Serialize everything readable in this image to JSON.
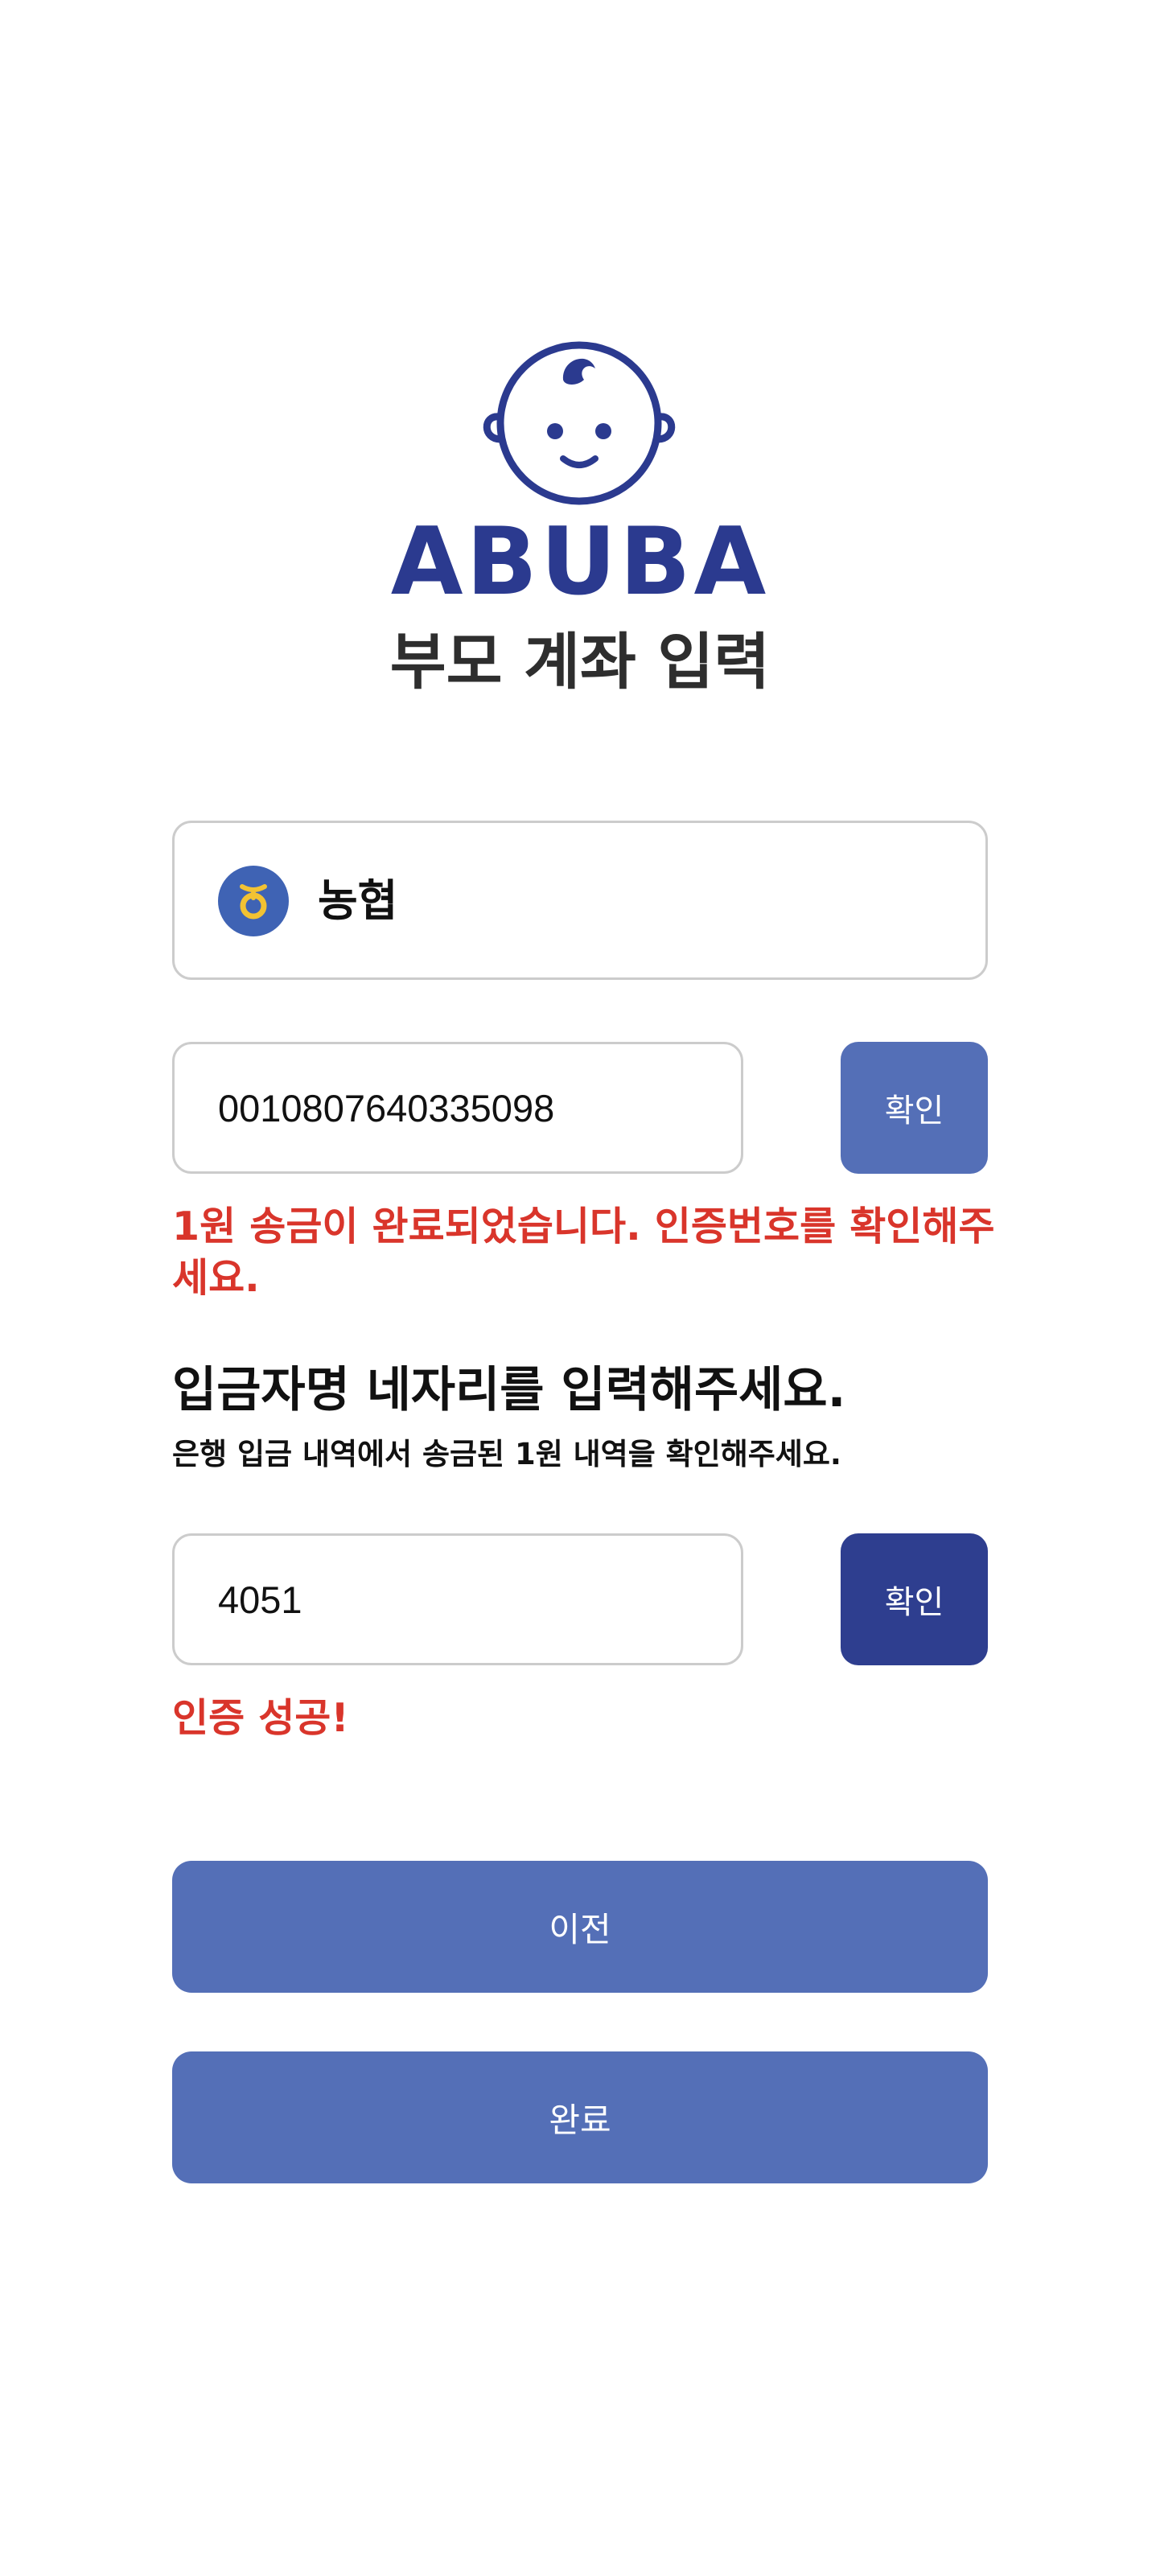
{
  "brand": {
    "name": "ABUBA",
    "logo_icon": "baby-face-icon",
    "color": "#2b3a8f"
  },
  "page_title": "부모 계좌 입력",
  "bank": {
    "name": "농협",
    "icon": "nh-bank-icon",
    "icon_color": "#3f63b4",
    "icon_mark_color": "#f2c233"
  },
  "account": {
    "value": "0010807640335098",
    "confirm_label": "확인",
    "confirm_color": "#546fb7",
    "message": "1원 송금이 완료되었습니다. 인증번호를 확인해주세요."
  },
  "verify": {
    "title": "입금자명 네자리를 입력해주세요.",
    "subtitle": "은행 입금 내역에서 송금된 1원 내역을 확인해주세요.",
    "value": "4051",
    "confirm_label": "확인",
    "confirm_color": "#2e3e8f",
    "message": "인증 성공!"
  },
  "nav": {
    "prev_label": "이전",
    "done_label": "완료",
    "button_color": "#546fb7"
  },
  "colors": {
    "error_red": "#d9352b",
    "border": "#cccccc"
  }
}
